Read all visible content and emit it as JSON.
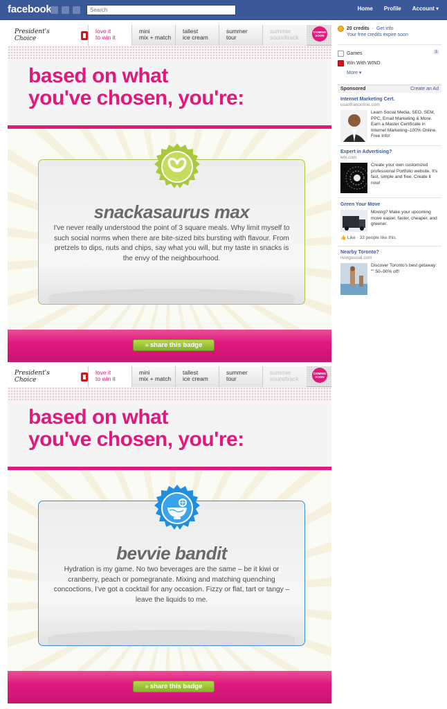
{
  "facebook": {
    "logo": "facebook",
    "search_placeholder": "Search",
    "nav": [
      "Home",
      "Profile",
      "Account ▾"
    ]
  },
  "app_nav": {
    "logo_text": "President's Choice",
    "tabs": [
      {
        "line1": "love it",
        "line2": "to win it"
      },
      {
        "line1": "mini",
        "line2": "mix + match"
      },
      {
        "line1": "tallest",
        "line2": "ice cream"
      },
      {
        "line1": "summer",
        "line2": "tour"
      },
      {
        "line1": "summer",
        "line2": "soundtrack"
      }
    ],
    "coming_soon": "COMING SOON"
  },
  "results": [
    {
      "headline": "based on what\nyou've chosen, you're:",
      "badge_icon": "pretzel-icon",
      "badge_color": "#a9c83c",
      "title": "snackasaurus max",
      "description": "I've never really understood the point of 3 square meals. Why limit myself to such social norms when there are bite-sized bits bursting with flavour. From pretzels to dips, nuts and chips, say what you will, but my taste in snacks is the envy of the neighbourhood.",
      "share_label": "share this badge"
    },
    {
      "headline": "based on what\nyou've chosen, you're:",
      "badge_icon": "punch-bowl-icon",
      "badge_color": "#1e8fe0",
      "title": "bevvie bandit",
      "description": "Hydration is my game. No two beverages are the same – be it kiwi or cranberry, peach or pomegranate. Mixing and matching quenching concoctions, I've got a cocktail for any occasion. Fizzy or flat, tart or tangy – leave the liquids to me.",
      "share_label": "share this badge"
    }
  ],
  "sidebar": {
    "credits_label": "20 credits",
    "credits_sep": " · ",
    "get_info": "Get info",
    "credits_note": "Your free credits expire soon",
    "apps": [
      {
        "label": "Games",
        "count": "1"
      },
      {
        "label": "Win With WIND",
        "count": ""
      }
    ],
    "more": "More ▾",
    "sponsored": "Sponsored",
    "create_ad": "Create an Ad",
    "ads": [
      {
        "title": "Internet Marketing Cert.",
        "url": "usanfranonline.com",
        "body": "Learn Social Media, SEO, SEM, PPC, Email Marketing & More. Earn a Master Certificate in Internet Marketing–100% Online. Free Info!",
        "like": ""
      },
      {
        "title": "Expert in Advertising?",
        "url": "wix.com",
        "body": "Create your own customized professional Portfolio website. It's fast, simple and free. Create it now!",
        "like": ""
      },
      {
        "title": "Green Your Move",
        "url": "",
        "body": "Moving? Make your upcoming move easier, faster, cheaper, and greener.",
        "like": "👍 Like · 33 people like this."
      },
      {
        "title": "Nearby Toronto?",
        "url": "livingsocial.com",
        "body": "Discover Toronto's best getaway: \"\" 50–90% off!",
        "like": ""
      }
    ]
  }
}
